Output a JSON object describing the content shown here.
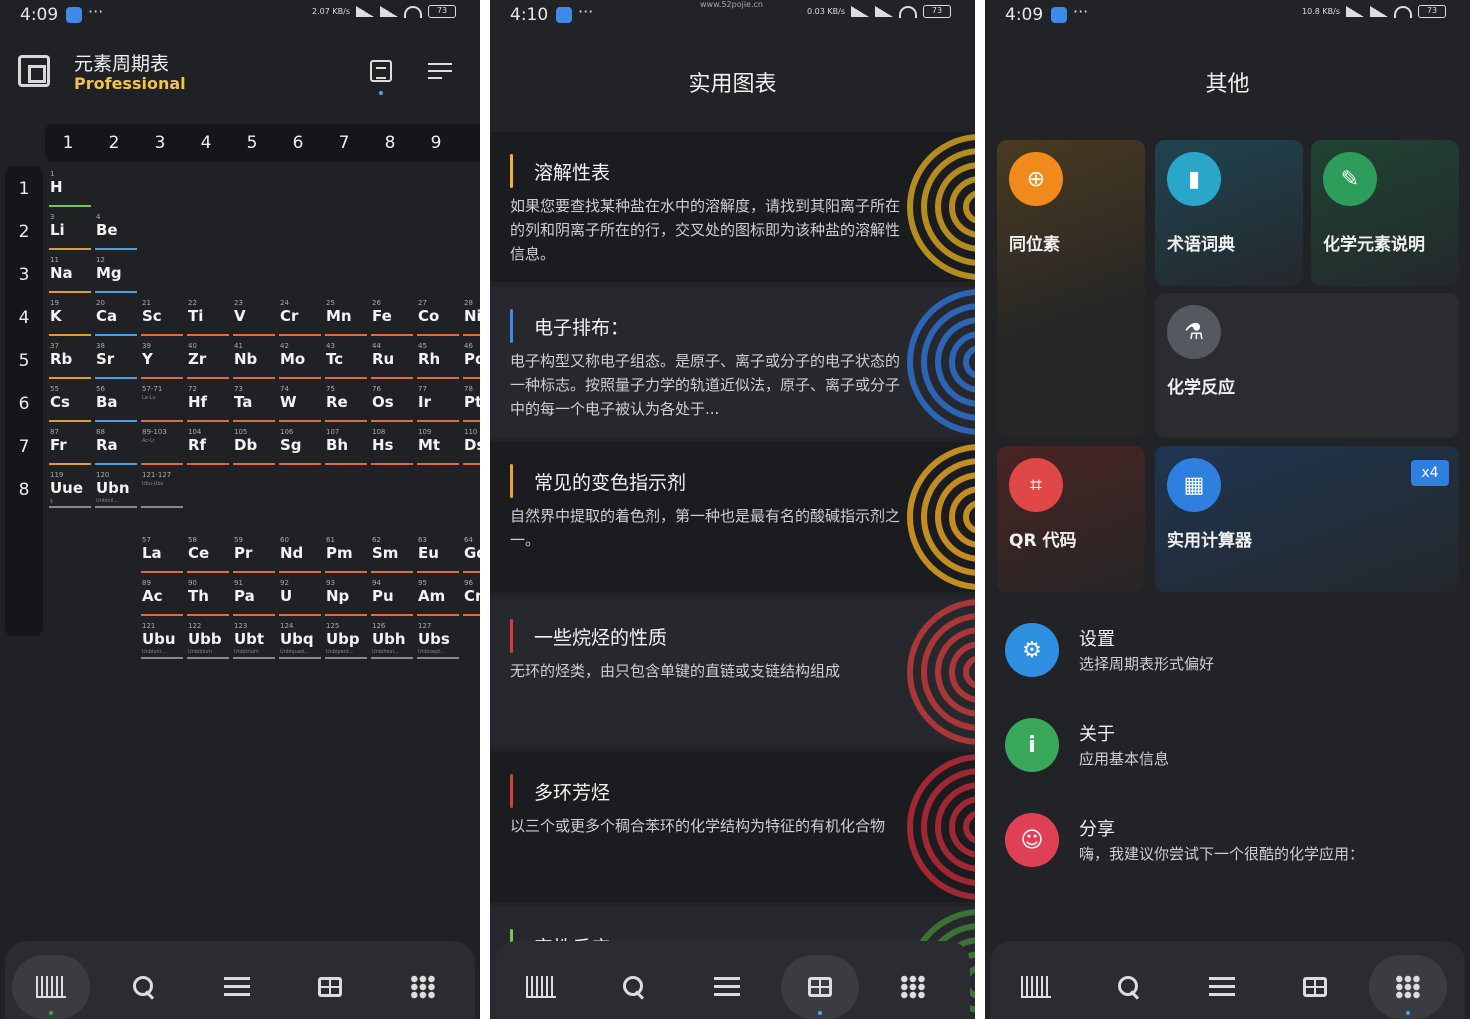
{
  "screen1": {
    "status": {
      "time": "4:09",
      "speed": "2.07 KB/s",
      "battery": "73"
    },
    "header": {
      "title": "元素周期表",
      "subtitle": "Professional"
    },
    "groups": [
      "1",
      "2",
      "3",
      "4",
      "5",
      "6",
      "7",
      "8",
      "9"
    ],
    "periods": [
      "1",
      "2",
      "3",
      "4",
      "5",
      "6",
      "7",
      "8"
    ],
    "elements": [
      {
        "n": "1",
        "s": "H",
        "g": 1,
        "p": 1,
        "c": "#7fc24a"
      },
      {
        "n": "3",
        "s": "Li",
        "g": 1,
        "p": 2,
        "c": "#e0a030"
      },
      {
        "n": "4",
        "s": "Be",
        "g": 2,
        "p": 2,
        "c": "#4aa0e0"
      },
      {
        "n": "11",
        "s": "Na",
        "g": 1,
        "p": 3,
        "c": "#e0a030"
      },
      {
        "n": "12",
        "s": "Mg",
        "g": 2,
        "p": 3,
        "c": "#4aa0e0"
      },
      {
        "n": "19",
        "s": "K",
        "g": 1,
        "p": 4,
        "c": "#e0a030"
      },
      {
        "n": "20",
        "s": "Ca",
        "g": 2,
        "p": 4,
        "c": "#4aa0e0"
      },
      {
        "n": "21",
        "s": "Sc",
        "g": 3,
        "p": 4,
        "c": "#e06a40"
      },
      {
        "n": "22",
        "s": "Ti",
        "g": 4,
        "p": 4,
        "c": "#e06a40"
      },
      {
        "n": "23",
        "s": "V",
        "g": 5,
        "p": 4,
        "c": "#e06a40"
      },
      {
        "n": "24",
        "s": "Cr",
        "g": 6,
        "p": 4,
        "c": "#e06a40"
      },
      {
        "n": "25",
        "s": "Mn",
        "g": 7,
        "p": 4,
        "c": "#e06a40"
      },
      {
        "n": "26",
        "s": "Fe",
        "g": 8,
        "p": 4,
        "c": "#e06a40"
      },
      {
        "n": "27",
        "s": "Co",
        "g": 9,
        "p": 4,
        "c": "#e06a40"
      },
      {
        "n": "28",
        "s": "Ni",
        "g": 10,
        "p": 4,
        "c": "#e06a40"
      },
      {
        "n": "37",
        "s": "Rb",
        "g": 1,
        "p": 5,
        "c": "#e0a030"
      },
      {
        "n": "38",
        "s": "Sr",
        "g": 2,
        "p": 5,
        "c": "#4aa0e0"
      },
      {
        "n": "39",
        "s": "Y",
        "g": 3,
        "p": 5,
        "c": "#e06a40"
      },
      {
        "n": "40",
        "s": "Zr",
        "g": 4,
        "p": 5,
        "c": "#e06a40"
      },
      {
        "n": "41",
        "s": "Nb",
        "g": 5,
        "p": 5,
        "c": "#e06a40"
      },
      {
        "n": "42",
        "s": "Mo",
        "g": 6,
        "p": 5,
        "c": "#e06a40"
      },
      {
        "n": "43",
        "s": "Tc",
        "g": 7,
        "p": 5,
        "c": "#e06a40"
      },
      {
        "n": "44",
        "s": "Ru",
        "g": 8,
        "p": 5,
        "c": "#e06a40"
      },
      {
        "n": "45",
        "s": "Rh",
        "g": 9,
        "p": 5,
        "c": "#e06a40"
      },
      {
        "n": "46",
        "s": "Pd",
        "g": 10,
        "p": 5,
        "c": "#e06a40"
      },
      {
        "n": "55",
        "s": "Cs",
        "g": 1,
        "p": 6,
        "c": "#e0a030"
      },
      {
        "n": "56",
        "s": "Ba",
        "g": 2,
        "p": 6,
        "c": "#4aa0e0"
      },
      {
        "n": "57-71",
        "s": "",
        "g": 3,
        "p": 6,
        "c": "#e06a40",
        "nm": "La-Lu"
      },
      {
        "n": "72",
        "s": "Hf",
        "g": 4,
        "p": 6,
        "c": "#e06a40"
      },
      {
        "n": "73",
        "s": "Ta",
        "g": 5,
        "p": 6,
        "c": "#e06a40"
      },
      {
        "n": "74",
        "s": "W",
        "g": 6,
        "p": 6,
        "c": "#e06a40"
      },
      {
        "n": "75",
        "s": "Re",
        "g": 7,
        "p": 6,
        "c": "#e06a40"
      },
      {
        "n": "76",
        "s": "Os",
        "g": 8,
        "p": 6,
        "c": "#e06a40"
      },
      {
        "n": "77",
        "s": "Ir",
        "g": 9,
        "p": 6,
        "c": "#e06a40"
      },
      {
        "n": "78",
        "s": "Pt",
        "g": 10,
        "p": 6,
        "c": "#e06a40"
      },
      {
        "n": "87",
        "s": "Fr",
        "g": 1,
        "p": 7,
        "c": "#e0a030"
      },
      {
        "n": "88",
        "s": "Ra",
        "g": 2,
        "p": 7,
        "c": "#4aa0e0"
      },
      {
        "n": "89-103",
        "s": "",
        "g": 3,
        "p": 7,
        "c": "#e06a40",
        "nm": "Ac-Lr"
      },
      {
        "n": "104",
        "s": "Rf",
        "g": 4,
        "p": 7,
        "c": "#e06a40"
      },
      {
        "n": "105",
        "s": "Db",
        "g": 5,
        "p": 7,
        "c": "#e06a40"
      },
      {
        "n": "106",
        "s": "Sg",
        "g": 6,
        "p": 7,
        "c": "#e06a40"
      },
      {
        "n": "107",
        "s": "Bh",
        "g": 7,
        "p": 7,
        "c": "#e06a40"
      },
      {
        "n": "108",
        "s": "Hs",
        "g": 8,
        "p": 7,
        "c": "#e06a40"
      },
      {
        "n": "109",
        "s": "Mt",
        "g": 9,
        "p": 7,
        "c": "#e06a40"
      },
      {
        "n": "110",
        "s": "Ds",
        "g": 10,
        "p": 7,
        "c": "#e06a40"
      },
      {
        "n": "119",
        "s": "Uue",
        "g": 1,
        "p": 8,
        "c": "#888888",
        "nm": "钅"
      },
      {
        "n": "120",
        "s": "Ubn",
        "g": 2,
        "p": 8,
        "c": "#888888",
        "nm": "Unbinil..."
      },
      {
        "n": "121-127",
        "s": "",
        "g": 3,
        "p": 8,
        "c": "#888888",
        "nm": "Ubu-Ubs"
      },
      {
        "n": "57",
        "s": "La",
        "g": 3,
        "p": 9.5,
        "c": "#e06a40"
      },
      {
        "n": "58",
        "s": "Ce",
        "g": 4,
        "p": 9.5,
        "c": "#e06a40"
      },
      {
        "n": "59",
        "s": "Pr",
        "g": 5,
        "p": 9.5,
        "c": "#e06a40"
      },
      {
        "n": "60",
        "s": "Nd",
        "g": 6,
        "p": 9.5,
        "c": "#e06a40"
      },
      {
        "n": "61",
        "s": "Pm",
        "g": 7,
        "p": 9.5,
        "c": "#e06a40"
      },
      {
        "n": "62",
        "s": "Sm",
        "g": 8,
        "p": 9.5,
        "c": "#e06a40"
      },
      {
        "n": "63",
        "s": "Eu",
        "g": 9,
        "p": 9.5,
        "c": "#e06a40"
      },
      {
        "n": "64",
        "s": "Gd",
        "g": 10,
        "p": 9.5,
        "c": "#e06a40"
      },
      {
        "n": "89",
        "s": "Ac",
        "g": 3,
        "p": 10.5,
        "c": "#e06a40"
      },
      {
        "n": "90",
        "s": "Th",
        "g": 4,
        "p": 10.5,
        "c": "#e06a40"
      },
      {
        "n": "91",
        "s": "Pa",
        "g": 5,
        "p": 10.5,
        "c": "#e06a40"
      },
      {
        "n": "92",
        "s": "U",
        "g": 6,
        "p": 10.5,
        "c": "#e06a40"
      },
      {
        "n": "93",
        "s": "Np",
        "g": 7,
        "p": 10.5,
        "c": "#e06a40"
      },
      {
        "n": "94",
        "s": "Pu",
        "g": 8,
        "p": 10.5,
        "c": "#e06a40"
      },
      {
        "n": "95",
        "s": "Am",
        "g": 9,
        "p": 10.5,
        "c": "#e06a40"
      },
      {
        "n": "96",
        "s": "Cm",
        "g": 10,
        "p": 10.5,
        "c": "#e06a40"
      },
      {
        "n": "121",
        "s": "Ubu",
        "g": 3,
        "p": 11.5,
        "c": "#888888",
        "nm": "Unbiuni..."
      },
      {
        "n": "122",
        "s": "Ubb",
        "g": 4,
        "p": 11.5,
        "c": "#888888",
        "nm": "Unbibium"
      },
      {
        "n": "123",
        "s": "Ubt",
        "g": 5,
        "p": 11.5,
        "c": "#888888",
        "nm": "Unbitrium"
      },
      {
        "n": "124",
        "s": "Ubq",
        "g": 6,
        "p": 11.5,
        "c": "#888888",
        "nm": "Unbiquad..."
      },
      {
        "n": "125",
        "s": "Ubp",
        "g": 7,
        "p": 11.5,
        "c": "#888888",
        "nm": "Unbipent..."
      },
      {
        "n": "126",
        "s": "Ubh",
        "g": 8,
        "p": 11.5,
        "c": "#888888",
        "nm": "Unbihexi..."
      },
      {
        "n": "127",
        "s": "Ubs",
        "g": 9,
        "p": 11.5,
        "c": "#888888",
        "nm": "Unbisept..."
      }
    ],
    "nav_active": 0
  },
  "screen2": {
    "status": {
      "time": "4:10",
      "speed": "0.03 KB/s",
      "battery": "73",
      "watermark": "www.52pojie.cn"
    },
    "title": "实用图表",
    "cards": [
      {
        "title": "溶解性表",
        "body": "如果您要查找某种盐在水中的溶解度，请找到其阳离子所在的列和阴离子所在的行，交叉处的图标即为该种盐的溶解性信息。",
        "accent": "#f2b233",
        "bg": "#1b1c20",
        "art": "#c79a1e"
      },
      {
        "title": "电子排布：",
        "body": "电子构型又称电子组态。是原子、离子或分子的电子状态的一种标志。按照量子力学的轨道近似法，原子、离子或分子中的每一个电子被认为各处于...",
        "accent": "#3d8be8",
        "bg": "#26282d",
        "art": "#2d6cc4"
      },
      {
        "title": "常见的变色指示剂",
        "body": "自然界中提取的着色剂，第一种也是最有名的酸碱指示剂之一。",
        "accent": "#f2a030",
        "bg": "#1b1c20",
        "art": "#d79a22"
      },
      {
        "title": "一些烷烃的性质",
        "body": "无环的烃类，由只包含单键的直链或支链结构组成",
        "accent": "#d83c3c",
        "bg": "#26282d",
        "art": "#b83838"
      },
      {
        "title": "多环芳烃",
        "body": "以三个或更多个稠合苯环的化学结构为特征的有机化合物",
        "accent": "#d83c3c",
        "bg": "#1b1c20",
        "art": "#b02a34"
      },
      {
        "title": "完性反应",
        "body": "",
        "accent": "#7fc24a",
        "bg": "#26282d",
        "art": "#3e7a36"
      }
    ],
    "nav_active": 3
  },
  "screen3": {
    "status": {
      "time": "4:09",
      "speed": "10.8 KB/s",
      "battery": "73"
    },
    "title": "其他",
    "tiles": [
      {
        "label": "同位素",
        "color": "#f08a1c",
        "glyph": "⊕"
      },
      {
        "label": "术语词典",
        "color": "#2aa7c8",
        "glyph": "▮"
      },
      {
        "label": "化学元素说明",
        "color": "#2e9c5a",
        "glyph": "✎"
      },
      {
        "label": "化学反应",
        "color": "#55585e",
        "glyph": "⚗"
      },
      {
        "label": "QR 代码",
        "color": "#e04848",
        "glyph": "⌗"
      },
      {
        "label": "实用计算器",
        "color": "#2f7fe0",
        "glyph": "▦",
        "badge": "x4"
      }
    ],
    "settings": [
      {
        "title": "设置",
        "sub": "选择周期表形式偏好",
        "color": "#2f8fe0",
        "glyph": "⚙"
      },
      {
        "title": "关于",
        "sub": "应用基本信息",
        "color": "#3aa85a",
        "glyph": "i"
      },
      {
        "title": "分享",
        "sub": "嗨，我建议你尝试下一个很酷的化学应用：",
        "color": "#e04055",
        "glyph": "☺"
      }
    ],
    "nav_active": 4
  },
  "nav_icons": [
    "chart-icon",
    "search-icon",
    "list-icon",
    "table-icon",
    "dots-icon"
  ]
}
